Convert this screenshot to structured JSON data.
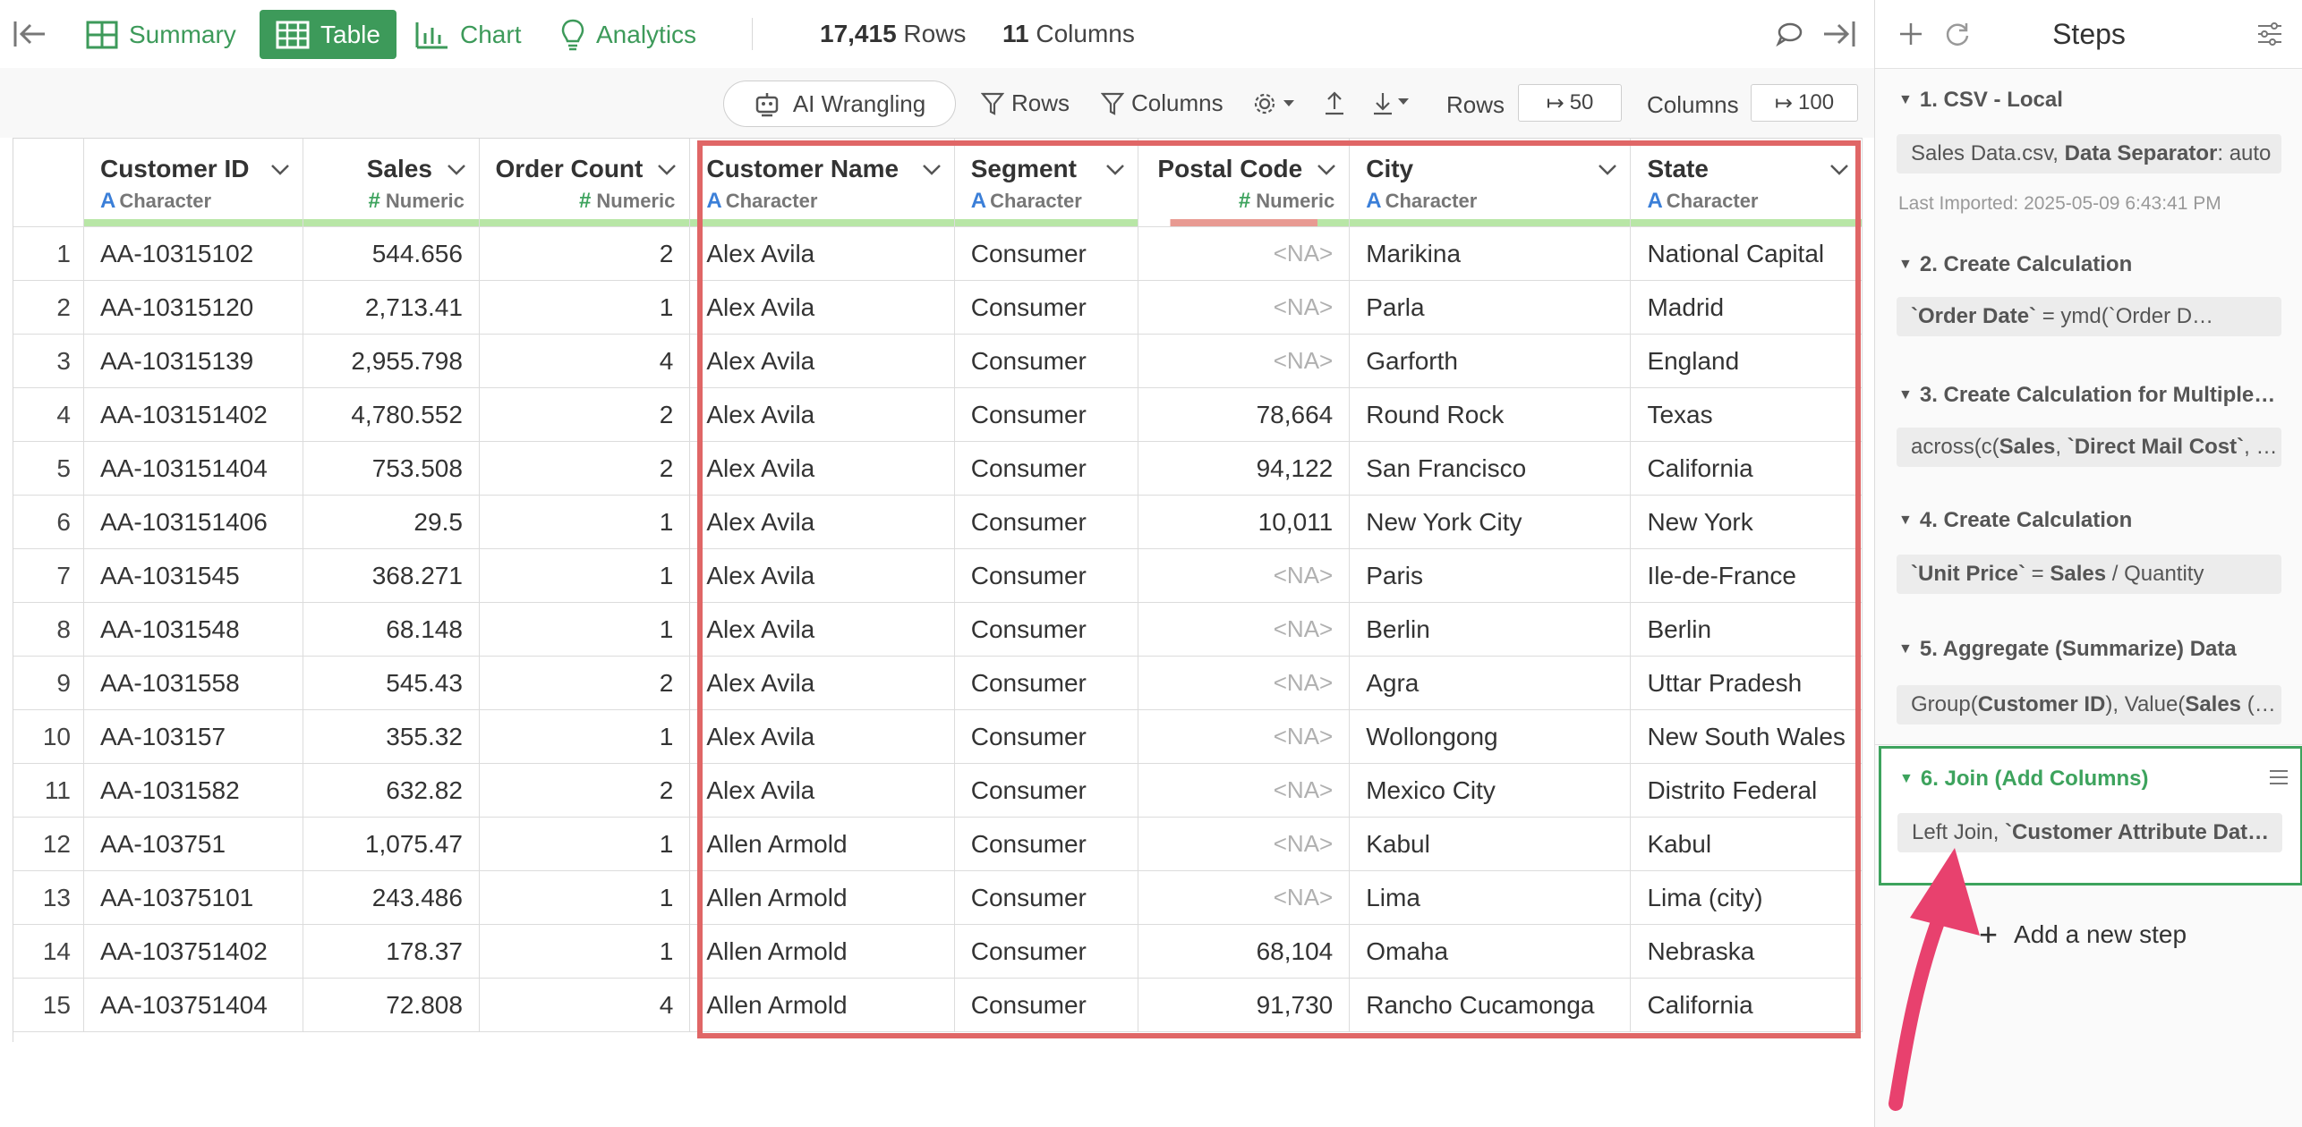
{
  "toolbar": {
    "views": [
      {
        "label": "Summary",
        "icon": "grid-icon"
      },
      {
        "label": "Table",
        "icon": "table-icon"
      },
      {
        "label": "Chart",
        "icon": "bar-chart-icon"
      },
      {
        "label": "Analytics",
        "icon": "lightbulb-icon"
      }
    ],
    "rows_count": "17,415",
    "rows_label": "Rows",
    "cols_count": "11",
    "cols_label": "Columns"
  },
  "toolbar2": {
    "ai_label": "AI Wrangling",
    "rows_filter": "Rows",
    "columns_filter": "Columns",
    "rows_label": "Rows",
    "rows_value": "50",
    "columns_label": "Columns",
    "columns_value": "100"
  },
  "grid": {
    "columns": [
      {
        "name": "Customer ID",
        "type": "Character"
      },
      {
        "name": "Sales",
        "type": "Numeric"
      },
      {
        "name": "Order Count",
        "type": "Numeric"
      },
      {
        "name": "Customer Name",
        "type": "Character"
      },
      {
        "name": "Segment",
        "type": "Character"
      },
      {
        "name": "Postal Code",
        "type": "Numeric"
      },
      {
        "name": "City",
        "type": "Character"
      },
      {
        "name": "State",
        "type": "Character"
      }
    ],
    "rows": [
      [
        "1",
        "AA-10315102",
        "544.656",
        "2",
        "Alex Avila",
        "Consumer",
        "<NA>",
        "Marikina",
        "National Capital"
      ],
      [
        "2",
        "AA-10315120",
        "2,713.41",
        "1",
        "Alex Avila",
        "Consumer",
        "<NA>",
        "Parla",
        "Madrid"
      ],
      [
        "3",
        "AA-10315139",
        "2,955.798",
        "4",
        "Alex Avila",
        "Consumer",
        "<NA>",
        "Garforth",
        "England"
      ],
      [
        "4",
        "AA-103151402",
        "4,780.552",
        "2",
        "Alex Avila",
        "Consumer",
        "78,664",
        "Round Rock",
        "Texas"
      ],
      [
        "5",
        "AA-103151404",
        "753.508",
        "2",
        "Alex Avila",
        "Consumer",
        "94,122",
        "San Francisco",
        "California"
      ],
      [
        "6",
        "AA-103151406",
        "29.5",
        "1",
        "Alex Avila",
        "Consumer",
        "10,011",
        "New York City",
        "New York"
      ],
      [
        "7",
        "AA-1031545",
        "368.271",
        "1",
        "Alex Avila",
        "Consumer",
        "<NA>",
        "Paris",
        "Ile-de-France"
      ],
      [
        "8",
        "AA-1031548",
        "68.148",
        "1",
        "Alex Avila",
        "Consumer",
        "<NA>",
        "Berlin",
        "Berlin"
      ],
      [
        "9",
        "AA-1031558",
        "545.43",
        "2",
        "Alex Avila",
        "Consumer",
        "<NA>",
        "Agra",
        "Uttar Pradesh"
      ],
      [
        "10",
        "AA-103157",
        "355.32",
        "1",
        "Alex Avila",
        "Consumer",
        "<NA>",
        "Wollongong",
        "New South Wales"
      ],
      [
        "11",
        "AA-1031582",
        "632.82",
        "2",
        "Alex Avila",
        "Consumer",
        "<NA>",
        "Mexico City",
        "Distrito Federal"
      ],
      [
        "12",
        "AA-103751",
        "1,075.47",
        "1",
        "Allen Armold",
        "Consumer",
        "<NA>",
        "Kabul",
        "Kabul"
      ],
      [
        "13",
        "AA-10375101",
        "243.486",
        "1",
        "Allen Armold",
        "Consumer",
        "<NA>",
        "Lima",
        "Lima (city)"
      ],
      [
        "14",
        "AA-103751402",
        "178.37",
        "1",
        "Allen Armold",
        "Consumer",
        "68,104",
        "Omaha",
        "Nebraska"
      ],
      [
        "15",
        "AA-103751404",
        "72.808",
        "4",
        "Allen Armold",
        "Consumer",
        "91,730",
        "Rancho Cucamonga",
        "California"
      ]
    ]
  },
  "steps": {
    "title": "Steps",
    "items": [
      {
        "title": "1. CSV - Local",
        "body_html": "Sales Data.csv, <b>Data Separator</b>: auto",
        "meta": "Last Imported: 2025-05-09 6:43:41 PM"
      },
      {
        "title": "2. Create Calculation",
        "body_html": "<b>`Order Date`</b> = ymd(`Order D…"
      },
      {
        "title": "3. Create Calculation for Multiple…",
        "body_html": "across(c(<b>Sales</b>, <b>`Direct Mail Cost`</b>, `…"
      },
      {
        "title": "4. Create Calculation",
        "body_html": "<b>`Unit Price`</b> = <b>Sales</b> / Quantity"
      },
      {
        "title": "5. Aggregate (Summarize) Data",
        "body_html": "Group(<b>Customer ID</b>), Value(<b>Sales</b> (…"
      },
      {
        "title": "6. Join (Add Columns)",
        "body_html": "Left Join, <b>`Customer Attribute Dat…</b>"
      }
    ],
    "add_label": "Add a new step"
  },
  "colors": {
    "accent": "#3d9a5a",
    "highlight": "#e06666",
    "arrow": "#e8416e"
  }
}
